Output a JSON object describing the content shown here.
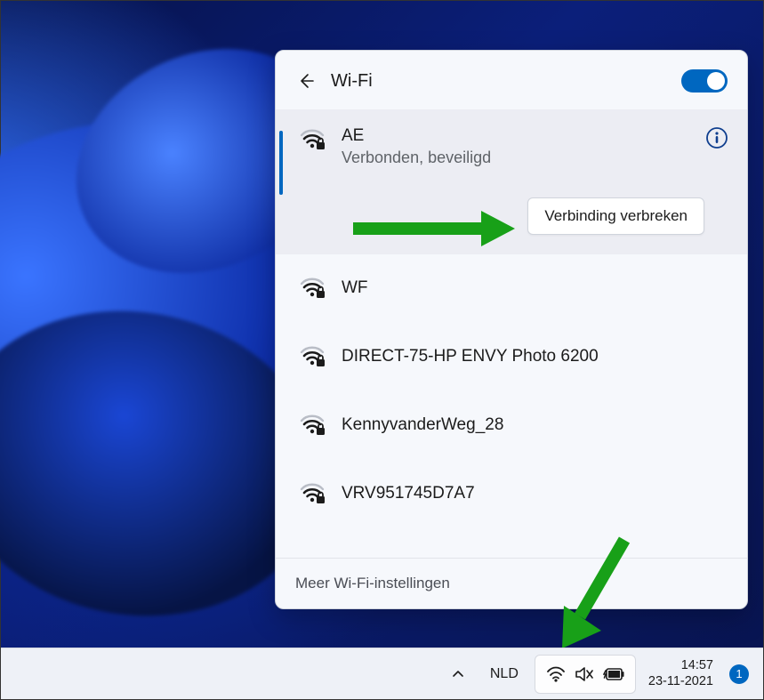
{
  "header": {
    "title": "Wi-Fi"
  },
  "networks": [
    {
      "name": "AE",
      "status": "Verbonden, beveiligd",
      "selected": true
    },
    {
      "name": "WF"
    },
    {
      "name": "DIRECT-75-HP ENVY Photo 6200"
    },
    {
      "name": "KennyvanderWeg_28"
    },
    {
      "name": "VRV951745D7A7"
    }
  ],
  "disconnect_label": "Verbinding verbreken",
  "more_settings_label": "Meer Wi-Fi-instellingen",
  "taskbar": {
    "language": "NLD",
    "time": "14:57",
    "date": "23-11-2021",
    "notif_count": "1"
  }
}
